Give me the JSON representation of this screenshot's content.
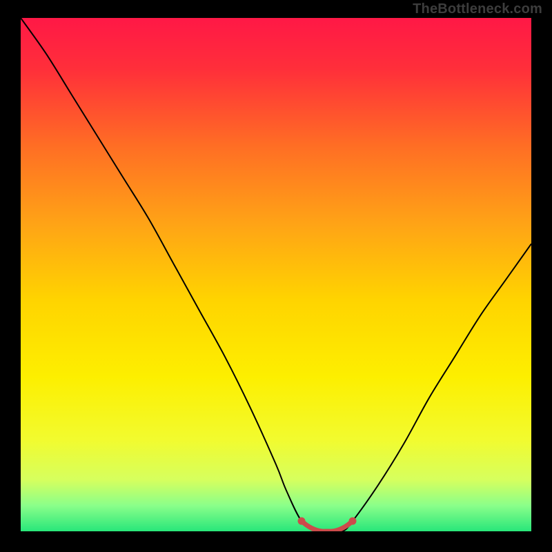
{
  "attribution": "TheBottleneck.com",
  "chart_data": {
    "type": "line",
    "title": "",
    "xlabel": "",
    "ylabel": "",
    "xlim": [
      0,
      100
    ],
    "ylim": [
      0,
      100
    ],
    "gradient_stops": [
      {
        "offset": 0.0,
        "color": "#ff1846"
      },
      {
        "offset": 0.1,
        "color": "#ff2f3a"
      },
      {
        "offset": 0.25,
        "color": "#ff6e24"
      },
      {
        "offset": 0.4,
        "color": "#ffa316"
      },
      {
        "offset": 0.55,
        "color": "#ffd400"
      },
      {
        "offset": 0.7,
        "color": "#fdef00"
      },
      {
        "offset": 0.82,
        "color": "#f2fb2e"
      },
      {
        "offset": 0.9,
        "color": "#d6ff5e"
      },
      {
        "offset": 0.95,
        "color": "#8aff8a"
      },
      {
        "offset": 1.0,
        "color": "#28e67a"
      }
    ],
    "series": [
      {
        "name": "bottleneck-curve",
        "color": "#000000",
        "x": [
          0,
          5,
          10,
          15,
          20,
          25,
          30,
          35,
          40,
          45,
          50,
          52,
          55,
          58,
          60,
          63,
          65,
          70,
          75,
          80,
          85,
          90,
          95,
          100
        ],
        "y": [
          100,
          93,
          85,
          77,
          69,
          61,
          52,
          43,
          34,
          24,
          13,
          8,
          2,
          0,
          0,
          0,
          2,
          9,
          17,
          26,
          34,
          42,
          49,
          56
        ]
      },
      {
        "name": "flat-zone-marker",
        "color": "#cc4b4b",
        "x": [
          55,
          56,
          57,
          58,
          59,
          60,
          61,
          62,
          63,
          64,
          65
        ],
        "y": [
          2.0,
          1.2,
          0.6,
          0.2,
          0.0,
          0.0,
          0.0,
          0.2,
          0.6,
          1.2,
          2.0
        ]
      }
    ]
  }
}
